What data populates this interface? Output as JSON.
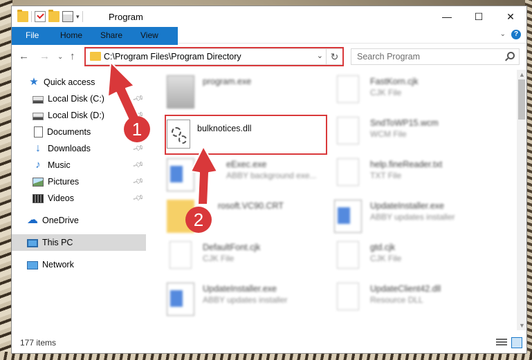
{
  "window": {
    "title": "Program",
    "controls": {
      "minimize": "—",
      "maximize": "☐",
      "close": "✕"
    }
  },
  "ribbon": {
    "tabs": [
      "File",
      "Home",
      "Share",
      "View"
    ],
    "help": "?"
  },
  "navigation": {
    "address": "C:\\Program Files\\Program Directory",
    "search_placeholder": "Search Program"
  },
  "sidebar": {
    "items": [
      {
        "label": "Quick access",
        "icon": "star-icon"
      },
      {
        "label": "Local Disk (C:)",
        "icon": "disk-icon",
        "pinned": true
      },
      {
        "label": "Local Disk (D:)",
        "icon": "disk-icon",
        "pinned": true
      },
      {
        "label": "Documents",
        "icon": "document-icon",
        "pinned": true
      },
      {
        "label": "Downloads",
        "icon": "download-icon",
        "pinned": true
      },
      {
        "label": "Music",
        "icon": "music-icon",
        "pinned": true
      },
      {
        "label": "Pictures",
        "icon": "pictures-icon",
        "pinned": true
      },
      {
        "label": "Videos",
        "icon": "videos-icon",
        "pinned": true
      },
      {
        "label": "OneDrive",
        "icon": "cloud-icon"
      },
      {
        "label": "This PC",
        "icon": "computer-icon",
        "selected": true
      },
      {
        "label": "Network",
        "icon": "network-icon"
      }
    ]
  },
  "files": [
    {
      "name": "program.exe",
      "type": ""
    },
    {
      "name": "FastKorn.cjk",
      "type": "CJK File"
    },
    {
      "name": "bulknotices.dll",
      "type": ""
    },
    {
      "name": "SndToWP15.wcm",
      "type": "WCM File"
    },
    {
      "name": "eExec.exe",
      "type": "ABBY background exe..."
    },
    {
      "name": "help.fineReader.txt",
      "type": "TXT File"
    },
    {
      "name": "rosoft.VC90.CRT",
      "type": ""
    },
    {
      "name": "UpdateInstaller.exe",
      "type": "ABBY updates installer"
    },
    {
      "name": "DefaultFont.cjk",
      "type": "CJK File"
    },
    {
      "name": "gtd.cjk",
      "type": "CJK File"
    },
    {
      "name": "UpdateInstaller.exe",
      "type": "ABBY updates installer"
    },
    {
      "name": "UpdateClient42.dll",
      "type": "Resource DLL"
    }
  ],
  "status": {
    "item_count": "177 items"
  },
  "annotations": {
    "step1": "1",
    "step2": "2",
    "highlight_color": "#d9383a"
  }
}
